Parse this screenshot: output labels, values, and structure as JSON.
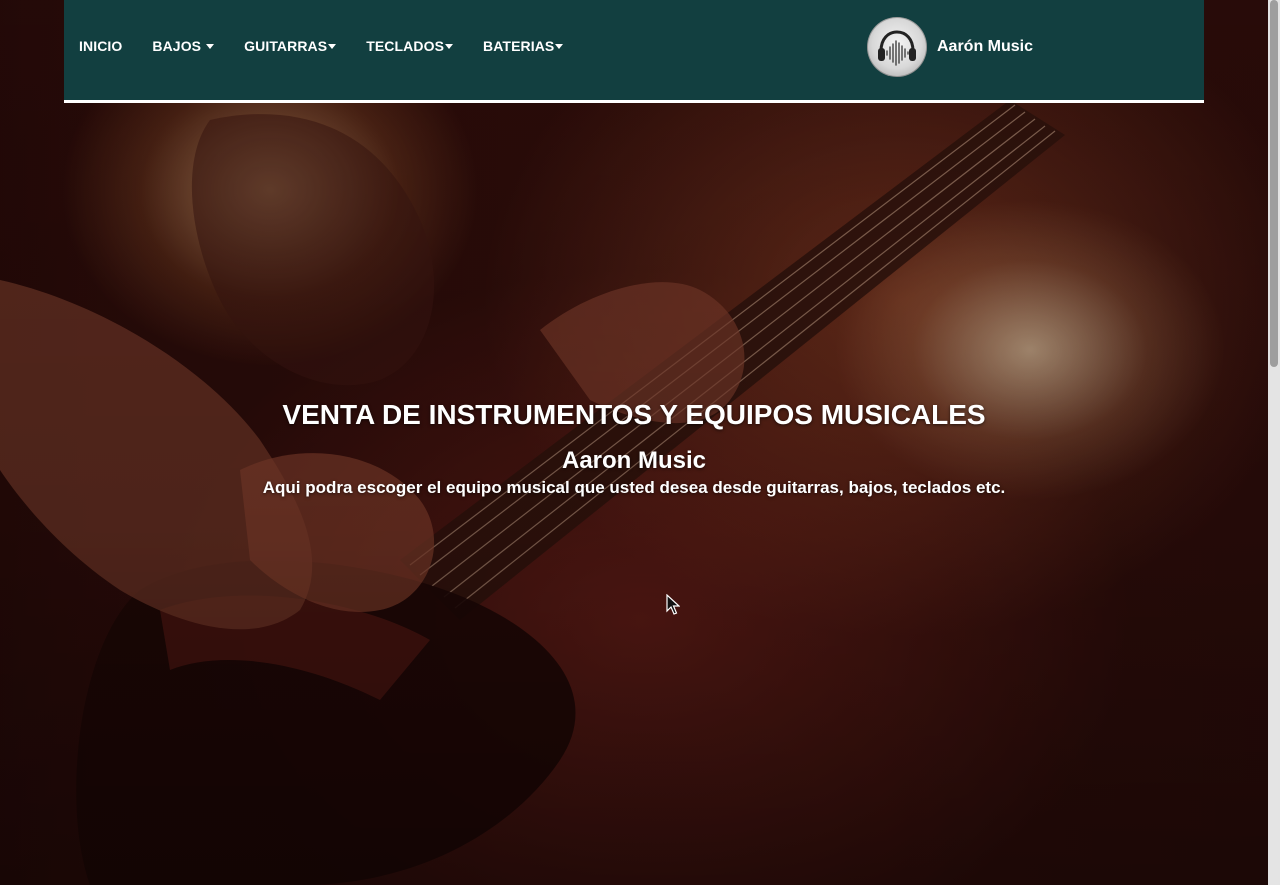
{
  "nav": {
    "items": [
      {
        "label": "INICIO",
        "dropdown": false
      },
      {
        "label": "BAJOS",
        "dropdown": true
      },
      {
        "label": "GUITARRAS",
        "dropdown": true
      },
      {
        "label": "TECLADOS",
        "dropdown": true
      },
      {
        "label": "BATERIAS",
        "dropdown": true
      }
    ],
    "brand_name": "Aarón Music",
    "background_color": "#123f40"
  },
  "hero": {
    "title": "VENTA DE INSTRUMENTOS Y EQUIPOS MUSICALES",
    "subtitle": "Aaron Music",
    "description": "Aqui podra escoger el equipo musical que usted desea desde guitarras, bajos, teclados etc."
  },
  "icons": {
    "logo": "headphones-soundwave-icon",
    "caret": "caret-down-icon",
    "cursor": "mouse-pointer-icon"
  }
}
